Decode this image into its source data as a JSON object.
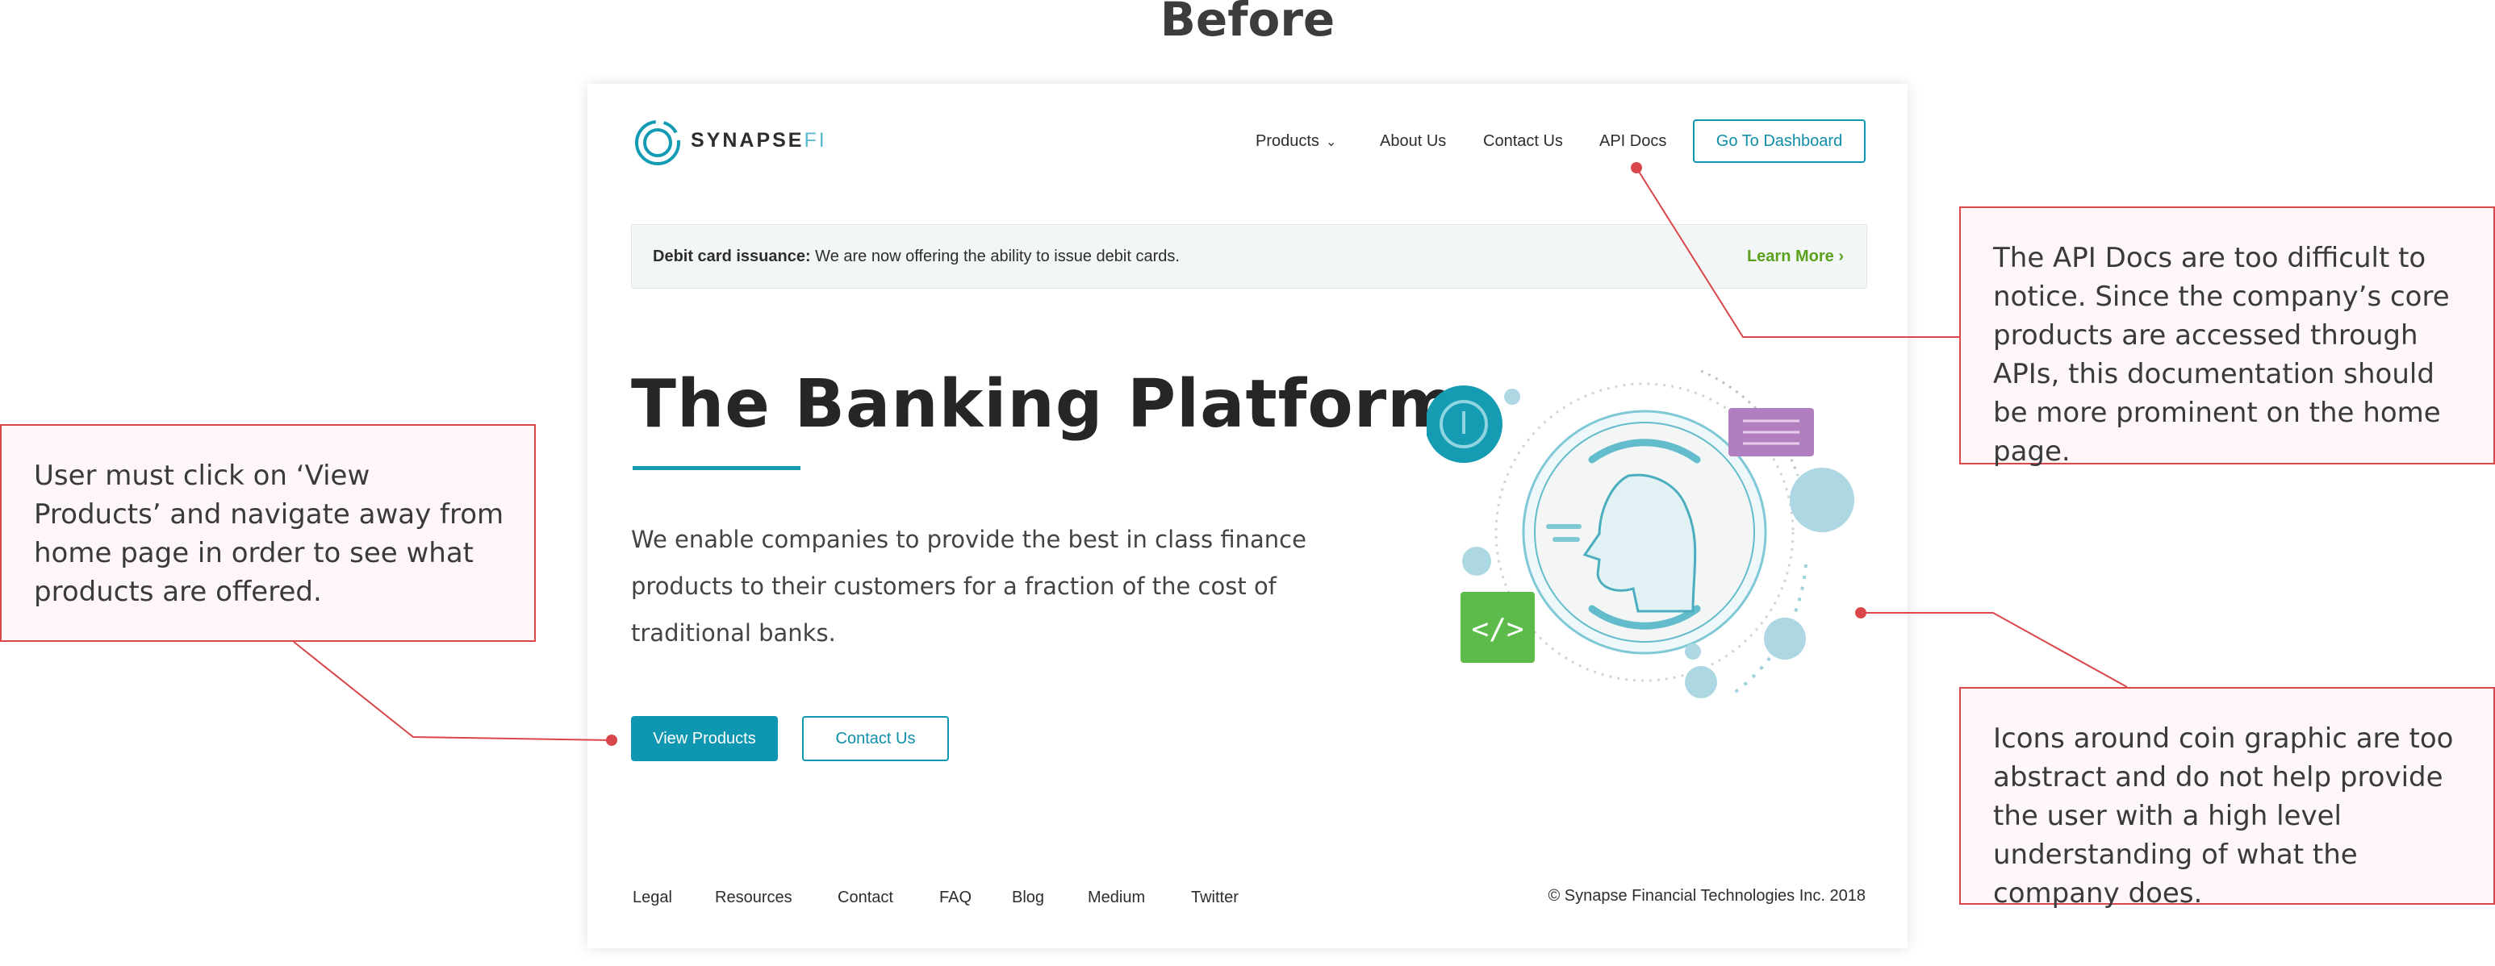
{
  "heading": "Before",
  "site": {
    "logo_text": "SYNAPSE",
    "logo_suffix": "FI",
    "nav": {
      "products": "Products",
      "about": "About Us",
      "contact": "Contact Us",
      "api_docs": "API Docs",
      "dashboard": "Go To Dashboard"
    },
    "banner": {
      "bold": "Debit card issuance:",
      "text": " We are now offering the ability to issue debit cards.",
      "link": "Learn More"
    },
    "hero": {
      "title": "The Banking Platform",
      "body": "We enable companies to provide the best in class finance products to their customers for a fraction of the cost of traditional banks.",
      "primary_button": "View Products",
      "secondary_button": "Contact Us"
    },
    "footer": {
      "links": [
        "Legal",
        "Resources",
        "Contact",
        "FAQ",
        "Blog",
        "Medium",
        "Twitter"
      ],
      "copyright": "© Synapse Financial Technologies Inc. 2018"
    }
  },
  "annotations": {
    "left": "User must click on ‘View Products’ and navigate away from home page in order to see what products are offered.",
    "api": "The API Docs are too difficult to notice. Since the company’s core products are accessed through APIs, this documentation should be more prominent on the home page.",
    "icons": "Icons around coin graphic are too abstract and do not help provide the user with a high level understanding of what the company does."
  },
  "colors": {
    "accent": "#0f96b0",
    "annotation_border": "#d9474a",
    "annotation_fill": "#fff7f7",
    "learn_more": "#5aa11e"
  },
  "icons": [
    "chevron-down-icon",
    "chevron-right-icon",
    "synapse-logo-icon",
    "coin-illustration"
  ]
}
